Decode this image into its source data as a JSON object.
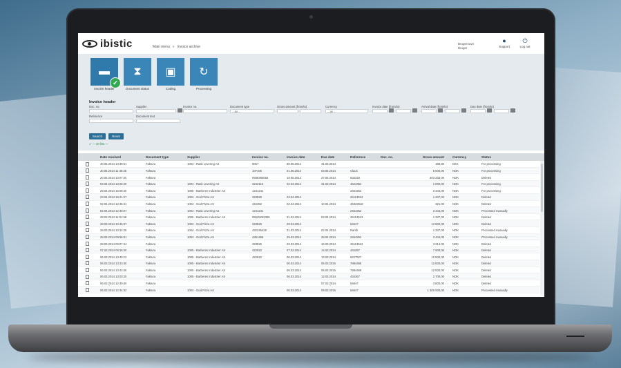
{
  "app": {
    "brand": "ibistic",
    "breadcrumb": [
      "Main menu",
      "»",
      "Invoice archive"
    ],
    "user": {
      "line1": "Brugernavn",
      "line2": "Bruger"
    },
    "toolbar": {
      "support_label": "Support",
      "logout_label": "Log out"
    }
  },
  "tiles": [
    {
      "label": "Invoice header",
      "icon": "invoice-header-icon",
      "active": true
    },
    {
      "label": "Document status",
      "icon": "hourglass-icon"
    },
    {
      "label": "Coding",
      "icon": "coding-icon"
    },
    {
      "label": "Processing",
      "icon": "refresh-icon"
    }
  ],
  "form": {
    "title": "Invoice header",
    "fields": {
      "doc_no": {
        "label": "Doc. no.",
        "value": ""
      },
      "supplier": {
        "label": "Supplier",
        "value": ""
      },
      "invoice_no": {
        "label": "Invoice no.",
        "value": ""
      },
      "document_type": {
        "label": "Document type",
        "value": "-- All --"
      },
      "gross_amount": {
        "label": "Gross amount (from/to)",
        "value": ""
      },
      "currency": {
        "label": "Currency",
        "value": "-- All --"
      },
      "invoice_date": {
        "label": "Invoice date (from/to)",
        "value": ""
      },
      "arrival_date": {
        "label": "Arrival date (from/to)",
        "value": ""
      },
      "due_date": {
        "label": "Due date (from/to)",
        "value": ""
      },
      "reference": {
        "label": "Reference",
        "value": ""
      },
      "document_text": {
        "label": "Document text",
        "value": ""
      }
    },
    "search_label": "Search",
    "reset_label": "Reset",
    "hint": "✔ — 20 hits —"
  },
  "table": {
    "columns": [
      "Date received",
      "Document type",
      "Supplier",
      "Invoice no.",
      "Invoice date",
      "Due date",
      "Reference",
      "Doc. no.",
      "Gross amount",
      "Currency",
      "Status"
    ],
    "rows": [
      [
        "30.05.2014 13:39:51",
        "Faktura",
        "1004 - Rask Levering AS",
        "9057",
        "30.05.2014",
        "31.03.2014",
        "",
        "",
        "198,80",
        "DKK",
        "For processing"
      ],
      [
        "30.05.2014 11:46:25",
        "Faktura",
        "",
        "107106",
        "01.05.2014",
        "03.06.2014",
        "Claus",
        "",
        "5 000,00",
        "NOK",
        "For processing"
      ],
      [
        "20.05.2014 13:07:20",
        "Faktura",
        "",
        "0938383083",
        "19.05.2014",
        "27.05.2014",
        "633333",
        "",
        "303 333,00",
        "NOK",
        "Deleted"
      ],
      [
        "03.04.2014 13:28:49",
        "Faktura",
        "1004 - Rask Levering AS",
        "3242116",
        "02.04.2014",
        "31.03.2014",
        "4524352",
        "",
        "1 090,00",
        "NOK",
        "For processing"
      ],
      [
        "29.04.2014 16:08:40",
        "Faktura",
        "1005 - Barberes Industrier AS",
        "1241241",
        "",
        "",
        "2454252",
        "",
        "3 444,00",
        "NOK",
        "For processing"
      ],
      [
        "23.04.2014 16:21:27",
        "Faktura",
        "1004 - God Pizza AS",
        "323525",
        "23.04.2014",
        "",
        "34113513",
        "",
        "1 337,00",
        "NOK",
        "Deleted"
      ],
      [
        "02.04.2014 12:36:31",
        "Faktura",
        "1004 - God Pizza AS",
        "442362",
        "02.04.2014",
        "10.04.2014",
        "46322618",
        "",
        "321,00",
        "NOK",
        "Deleted"
      ],
      [
        "02.04.2014 12:40:07",
        "Faktura",
        "1004 - Rask Levering AS",
        "1241241",
        "",
        "",
        "2454252",
        "",
        "3 444,00",
        "NOK",
        "Processed manually"
      ],
      [
        "28.03.2014 11:01:56",
        "Faktura",
        "1005 - Barberes Industrier AS",
        "05525252355",
        "31.03.2014",
        "03.04.2014",
        "34113513",
        "",
        "1 337,00",
        "NOK",
        "Deleted"
      ],
      [
        "28.03.2014 10:46:37",
        "Faktura",
        "1004 - God Pizza AS",
        "323525",
        "29.03.2014",
        "",
        "54647",
        "",
        "12 500,00",
        "NOK",
        "Deleted"
      ],
      [
        "28.03.2014 10:22:28",
        "Faktura",
        "1004 - God Pizza AS",
        "432245425",
        "31.03.2014",
        "02.04.2014",
        "Ramfi",
        "",
        "1 337,00",
        "NOK",
        "Processed manually"
      ],
      [
        "28.03.2014 09:56:01",
        "Faktura",
        "1004 - God Pizza AS",
        "4351466",
        "29.03.2014",
        "28.04.2014",
        "2454252",
        "",
        "3 444,00",
        "NOK",
        "Processed manually"
      ],
      [
        "28.03.2014 09:07:44",
        "Faktura",
        "",
        "323525",
        "29.03.2014",
        "16.03.2014",
        "34113513",
        "",
        "3 214,00",
        "NOK",
        "Deleted"
      ],
      [
        "07.03.2014 09:26:28",
        "Faktura",
        "1005 - Barberes Industrier AS",
        "422622",
        "07.03.2014",
        "14.03.2014",
        "434367",
        "",
        "7 500,00",
        "NOK",
        "Deleted"
      ],
      [
        "06.03.2014 13:49:12",
        "Faktura",
        "1005 - Barberes Industrier AS",
        "422622",
        "06.03.2014",
        "13.03.2014",
        "6227527",
        "",
        "12 500,00",
        "NOK",
        "Deleted"
      ],
      [
        "06.03.2014 13:43:45",
        "Faktura",
        "1005 - Barberes Industrier AS",
        "",
        "06.03.2014",
        "05.03.2015",
        "7884468",
        "",
        "12 000,00",
        "NOK",
        "Deleted"
      ],
      [
        "06.03.2014 13:43:45",
        "Faktura",
        "1005 - Barberes Industrier AS",
        "",
        "06.03.2014",
        "05.03.2015",
        "7884468",
        "",
        "12 000,00",
        "NOK",
        "Deleted"
      ],
      [
        "06.03.2014 13:03:25",
        "Faktura",
        "1005 - Barberes Industrier AS",
        "",
        "06.03.2014",
        "12.03.2014",
        "434367",
        "",
        "2 700,00",
        "NOK",
        "Deleted"
      ],
      [
        "06.03.2014 12:49:45",
        "Faktura",
        "",
        "",
        "",
        "07.03.2014",
        "54647",
        "",
        "3 500,00",
        "NOK",
        "Deleted"
      ],
      [
        "06.03.2014 12:44:33",
        "Faktura",
        "1004 - God Pizza AS",
        "",
        "06.03.2014",
        "09.03.2015",
        "54647",
        "",
        "1 300 000,00",
        "NOK",
        "Processed manually"
      ]
    ]
  }
}
